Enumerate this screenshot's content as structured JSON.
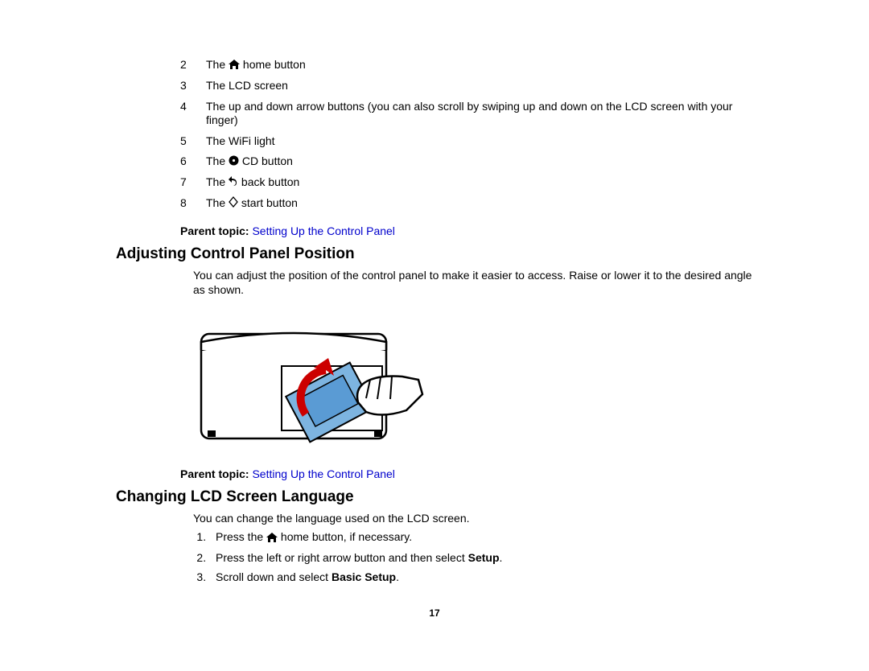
{
  "legend": [
    {
      "num": "2",
      "pre": "The ",
      "icon": "home",
      "post": " home button"
    },
    {
      "num": "3",
      "pre": "The LCD screen",
      "icon": null,
      "post": ""
    },
    {
      "num": "4",
      "pre": "The up and down arrow buttons (you can also scroll by swiping up and down on the LCD screen with your finger)",
      "icon": null,
      "post": ""
    },
    {
      "num": "5",
      "pre": "The WiFi light",
      "icon": null,
      "post": ""
    },
    {
      "num": "6",
      "pre": "The ",
      "icon": "cd",
      "post": " CD button"
    },
    {
      "num": "7",
      "pre": "The ",
      "icon": "back",
      "post": " back button"
    },
    {
      "num": "8",
      "pre": "The ",
      "icon": "start",
      "post": " start button"
    }
  ],
  "parent_topic_label": "Parent topic: ",
  "parent_topic_link": "Setting Up the Control Panel",
  "section1_title": "Adjusting Control Panel Position",
  "section1_body": "You can adjust the position of the control panel to make it easier to access. Raise or lower it to the desired angle as shown.",
  "section2_title": "Changing LCD Screen Language",
  "section2_body": "You can change the language used on the LCD screen.",
  "steps": {
    "s1_pre": "Press the ",
    "s1_post": " home button, if necessary.",
    "s2_pre": "Press the left or right arrow button and then select ",
    "s2_bold": "Setup",
    "s2_post": ".",
    "s3_pre": "Scroll down and select ",
    "s3_bold": "Basic Setup",
    "s3_post": "."
  },
  "page_number": "17"
}
